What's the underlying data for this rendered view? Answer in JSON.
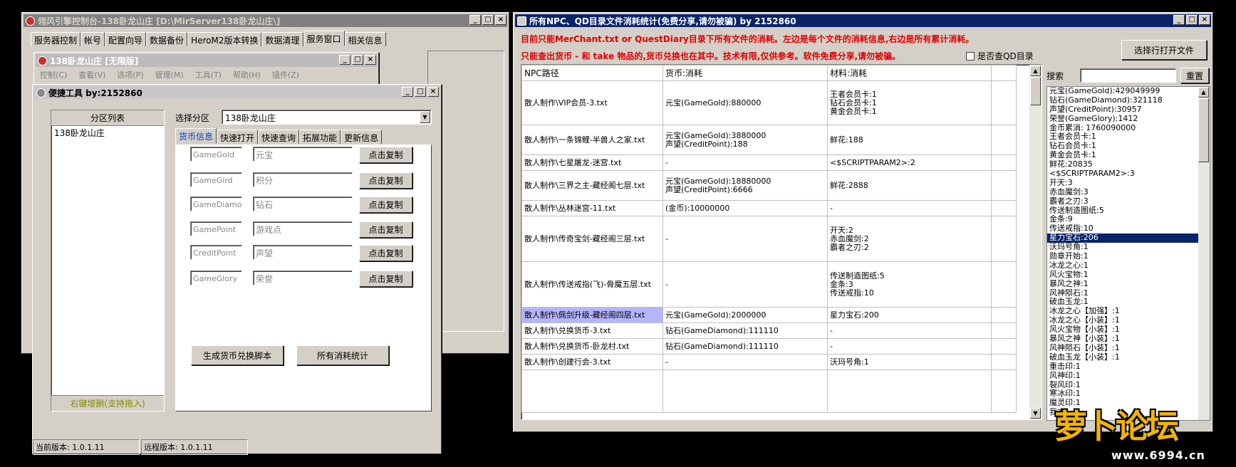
{
  "main_window": {
    "title": "翎风引擎控制台-138卧龙山庄 [D:\\MirServer138卧龙山庄\\]",
    "tabs": [
      "服务器控制",
      "帐号",
      "配置向导",
      "数据备份",
      "HeroM2版本转换",
      "数据清理",
      "服务窗口",
      "相关信息"
    ],
    "active_tab": "服务窗口"
  },
  "server_window": {
    "title": "138卧龙山庄 [无限版]",
    "menu": [
      "控制(C)",
      "查看(V)",
      "选项(P)",
      "管理(M)",
      "工具(T)",
      "帮助(H)",
      "插件(Z)"
    ]
  },
  "tool_window": {
    "title": "便捷工具  by:2152860",
    "zone_list_header": "分区列表",
    "zone_items": [
      "138卧龙山庄"
    ],
    "zone_footer": "右键增删(支持拖入)",
    "select_zone_label": "选择分区",
    "select_zone_value": "138卧龙山庄",
    "tabs": [
      "货币信息",
      "快速打开",
      "快速查询",
      "拓展功能",
      "更新信息"
    ],
    "currency_rows": [
      {
        "key": "GameGold",
        "name": "元宝",
        "button": "点击复制"
      },
      {
        "key": "GameGird",
        "name": "积分",
        "button": "点击复制"
      },
      {
        "key": "GameDiamond",
        "name": "钻石",
        "button": "点击复制"
      },
      {
        "key": "GamePoint",
        "name": "游戏点",
        "button": "点击复制"
      },
      {
        "key": "CreditPoint",
        "name": "声望",
        "button": "点击复制"
      },
      {
        "key": "GameGlory",
        "name": "荣誉",
        "button": "点击复制"
      }
    ],
    "gen_button": "生成货币兑换脚本",
    "stats_button": "所有消耗统计",
    "status_local": "当前版本: 1.0.1.11",
    "status_remote": "远程版本: 1.0.1.11"
  },
  "stats_window": {
    "title": "所有NPC、QD目录文件消耗统计(免费分享,请勿被骗)    by 2152860",
    "note1": "目前只能MerChant.txt or QuestDiary目录下所有文件的消耗。左边是每个文件的消耗信息,右边是所有累计消耗。",
    "note2": "只能查出货币 - 和 take 物品的,货币兑换也在其中。技术有限,仅供参考。软件免费分享,请勿被骗。",
    "qd_checkbox": "是否查QD目录",
    "open_file_button": "选择行打开文件",
    "search_label": "搜索",
    "reset_button": "重置",
    "columns": [
      "NPC路径",
      "货币:消耗",
      "材料:消耗"
    ],
    "rows": [
      {
        "path": "散人制作\\VIP会员-3.txt",
        "currency": "元宝(GameGold):880000",
        "material": "王者会员卡:1\n钻石会员卡:1\n黄金会员卡:1"
      },
      {
        "path": "散人制作\\一条锦鲤-半兽人之家.txt",
        "currency": "元宝(GameGold):3880000\n声望(CreditPoint):188",
        "material": "鲜花:188"
      },
      {
        "path": "散人制作\\七星屠龙-迷宫.txt",
        "currency": "-",
        "material": "<$SCRIPTPARAM2>:2"
      },
      {
        "path": "散人制作\\三界之主-藏经阁七层.txt",
        "currency": "元宝(GameGold):18880000\n声望(CreditPoint):6666",
        "material": "鲜花:2888"
      },
      {
        "path": "散人制作\\丛林迷宫-11.txt",
        "currency": "(金币):10000000",
        "material": "-"
      },
      {
        "path": "散人制作\\传奇宝剑-藏经阁三层.txt",
        "currency": "-",
        "material": "开天:2\n赤血魔剑:2\n霸者之刃:2"
      },
      {
        "path": "散人制作\\传送戒指(飞)-骨魔五层.txt",
        "currency": "-",
        "material": "传送制造图纸:5\n金条:3\n传送戒指:10"
      },
      {
        "path": "散人制作\\佩剑升级-藏经阁四层.txt",
        "currency": "元宝(GameGold):2000000",
        "material": "星力宝石:200"
      },
      {
        "path": "散人制作\\兑换货币-3.txt",
        "currency": "钻石(GameDiamond):111110",
        "material": "-"
      },
      {
        "path": "散人制作\\兑换货币-卧龙村.txt",
        "currency": "钻石(GameDiamond):111110",
        "material": "-"
      },
      {
        "path": "散人制作\\创建行会-3.txt",
        "currency": "-",
        "material": "沃玛号角:1"
      }
    ],
    "summary": [
      "元宝(GameGold):429049999",
      "钻石(GameDiamond):321118",
      "声望(CreditPoint):30957",
      "荣誉(GameGlory):1412",
      "金币累消: 1760090000",
      "王者会员卡:1",
      "钻石会员卡:1",
      "黄金会员卡:1",
      "鲜花:20835",
      "<$SCRIPTPARAM2>:3",
      "开天:3",
      "赤血魔剑:3",
      "霸者之刃:3",
      "传送制造图纸:5",
      "金条:9",
      "传送戒指:10",
      "星力宝石:206",
      "沃玛号角:1",
      "勋章开始:1",
      "冰龙之心:1",
      "风火宝物:1",
      "暴风之神:1",
      "风神陨石:1",
      "破血玉龙:1",
      "冰龙之心【加强】:1",
      "冰龙之心【小装】:1",
      "风火宝物【小装】:1",
      "暴风之神【小装】:1",
      "风神陨石【小装】:1",
      "破血玉龙【小装】:1",
      "重击印:1",
      "风神印:1",
      "裂风印:1",
      "寒冰印:1",
      "魔灵印:1",
      "我本"
    ],
    "selected_summary": "星力宝石:206"
  },
  "watermark": {
    "brand": "萝卜论坛",
    "url": "www.6994.cn"
  }
}
